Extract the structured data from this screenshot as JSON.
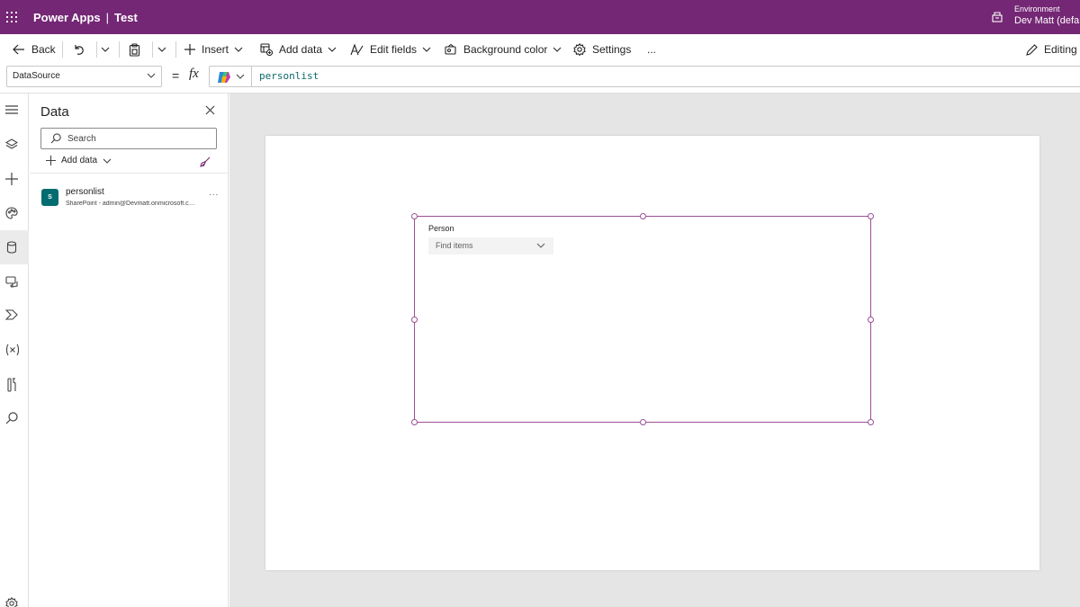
{
  "app": {
    "title": "Power Apps",
    "separator": "|",
    "app_name": "Test",
    "environment_label": "Environment",
    "environment_name": "Dev Matt (defa"
  },
  "toolbar": {
    "back": "Back",
    "insert": "Insert",
    "add_data": "Add data",
    "edit_fields": "Edit fields",
    "background_color": "Background color",
    "settings": "Settings",
    "more": "...",
    "editing": "Editing"
  },
  "formula_bar": {
    "property": "DataSource",
    "equals": "=",
    "fx": "fx",
    "formula": "personlist"
  },
  "rail": {
    "items": [
      "menu-icon",
      "layers-icon",
      "plus-icon",
      "palette-icon",
      "database-icon",
      "media-icon",
      "power-automate-icon",
      "variables-icon",
      "tools-icon",
      "search-icon",
      "settings-icon"
    ],
    "active": "database-icon"
  },
  "data_panel": {
    "title": "Data",
    "search_placeholder": "Search",
    "add_data": "Add data",
    "sources": [
      {
        "name": "personlist",
        "subtitle": "SharePoint - admin@Devmatt.onmicrosoft.com",
        "more": "...",
        "icon_text": "S"
      }
    ]
  },
  "canvas": {
    "card": {
      "label": "Person",
      "combo_placeholder": "Find items"
    }
  },
  "colors": {
    "topbar": "#742774",
    "selection": "#9b4f96",
    "sharepoint": "#036c70",
    "canvas_bg": "#e5e5e5"
  }
}
